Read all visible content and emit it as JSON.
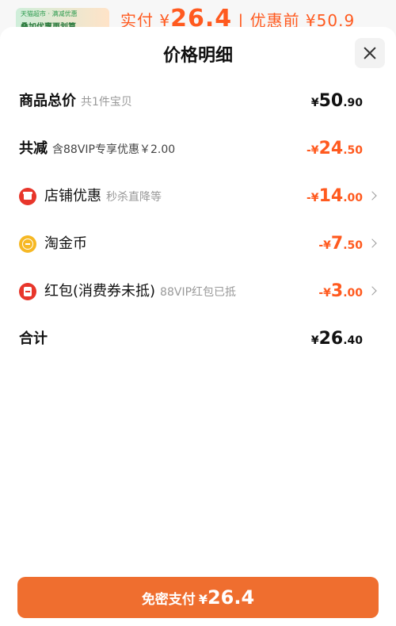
{
  "background": {
    "badge_line1": "天猫超市 · 满减优惠",
    "badge_line2": "叠加优惠更划算",
    "price_prefix": "实付 ¥",
    "price_value": "26.4",
    "price_suffix": " | 优惠前 ¥50.9"
  },
  "sheet": {
    "title": "价格明细"
  },
  "rows": {
    "total": {
      "label": "商品总价",
      "sub": "共1件宝贝",
      "currency": "¥",
      "int": "50",
      "dec": ".90"
    },
    "reduce": {
      "label": "共减",
      "sub": "含88VIP专享优惠￥2.00",
      "prefix": "-¥",
      "int": "24",
      "dec": ".50"
    },
    "store": {
      "label": "店铺优惠",
      "sub": "秒杀直降等",
      "prefix": "-¥",
      "int": "14",
      "dec": ".00"
    },
    "coin": {
      "label": "淘金币",
      "prefix": "-¥",
      "int": "7",
      "dec": ".50"
    },
    "redpack": {
      "label": "红包(消费券未抵)",
      "sub": "88VIP红包已抵",
      "prefix": "-¥",
      "int": "3",
      "dec": ".00"
    },
    "sum": {
      "label": "合计",
      "currency": "¥",
      "int": "26",
      "dec": ".40"
    }
  },
  "pay_button": {
    "label": "免密支付",
    "currency": "¥",
    "amount": "26.4"
  },
  "colors": {
    "accent": "#ff5a1f",
    "button": "#ef6e2f",
    "red_icon": "#e8362b",
    "coin_icon": "#f6b824"
  },
  "icons": {
    "close": "close-icon",
    "store": "store-icon",
    "coin": "coin-icon",
    "redpack": "red-packet-icon",
    "chevron": "chevron-right-icon"
  }
}
